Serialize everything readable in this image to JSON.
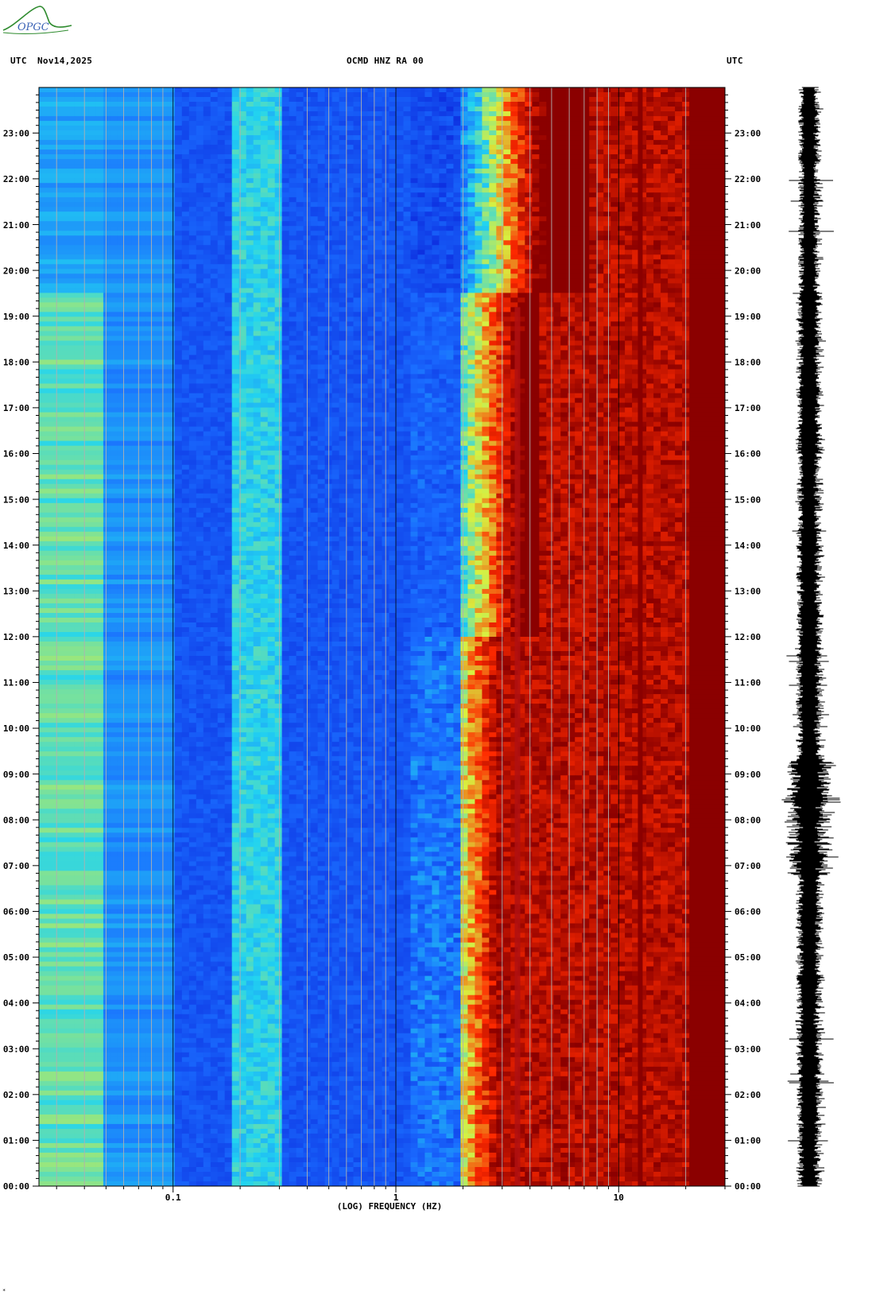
{
  "logo": {
    "text": "OPGC",
    "accent": "#2e8b2e",
    "text_color": "#3b63b6"
  },
  "header": {
    "left_tz": "UTC",
    "date": "Nov14,2025",
    "title": "OCMD HNZ RA 00",
    "right_tz": "UTC"
  },
  "footnote": "*",
  "chart_data": {
    "type": "heatmap",
    "title": "OCMD HNZ RA 00",
    "xlabel": "(LOG) FREQUENCY (HZ)",
    "ylabel": "",
    "x_scale": "log",
    "xlim": [
      0.025,
      30
    ],
    "x_ticks": [
      {
        "value": 0.1,
        "label": "0.1"
      },
      {
        "value": 1,
        "label": "1"
      },
      {
        "value": 10,
        "label": "10"
      }
    ],
    "y_range_hours": [
      0,
      24
    ],
    "y_ticks": [
      "00:00",
      "01:00",
      "02:00",
      "03:00",
      "04:00",
      "05:00",
      "06:00",
      "07:00",
      "08:00",
      "09:00",
      "10:00",
      "11:00",
      "12:00",
      "13:00",
      "14:00",
      "15:00",
      "16:00",
      "17:00",
      "18:00",
      "19:00",
      "20:00",
      "21:00",
      "22:00",
      "23:00"
    ],
    "colormap": [
      "#0a20d8",
      "#1a6cff",
      "#22d4f0",
      "#d8f040",
      "#ff2a00",
      "#8b0000"
    ],
    "features": {
      "saturated_band_start_hz": 3.0,
      "saturated_full_hz": 20,
      "persistent_line_hz": 3.5,
      "strong_line_hz": 12.5,
      "low_freq_band_hz": [
        0.025,
        0.05
      ],
      "microseism_band_hz": [
        0.18,
        0.3
      ]
    },
    "seismogram": {
      "color": "#000000"
    }
  }
}
